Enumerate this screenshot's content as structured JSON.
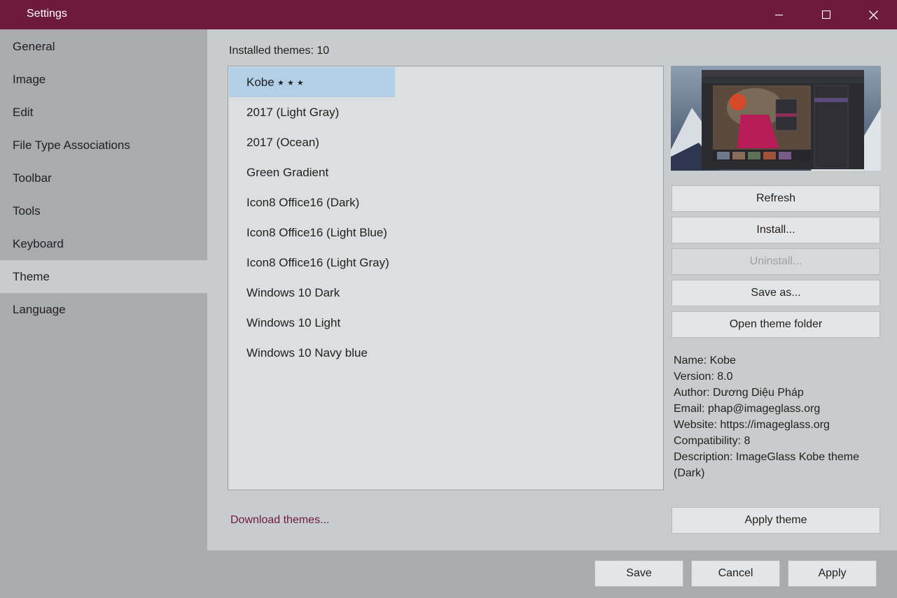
{
  "window": {
    "title": "Settings"
  },
  "sidebar": {
    "items": [
      {
        "label": "General"
      },
      {
        "label": "Image"
      },
      {
        "label": "Edit"
      },
      {
        "label": "File Type Associations"
      },
      {
        "label": "Toolbar"
      },
      {
        "label": "Tools"
      },
      {
        "label": "Keyboard"
      },
      {
        "label": "Theme",
        "active": true
      },
      {
        "label": "Language"
      }
    ]
  },
  "theme_page": {
    "installed_label": "Installed themes: 10",
    "themes": [
      {
        "name": "Kobe ⭑ ⭑ ⭑",
        "selected": true
      },
      {
        "name": "2017 (Light Gray)"
      },
      {
        "name": "2017 (Ocean)"
      },
      {
        "name": "Green Gradient"
      },
      {
        "name": "Icon8 Office16 (Dark)"
      },
      {
        "name": "Icon8 Office16 (Light Blue)"
      },
      {
        "name": "Icon8 Office16 (Light Gray)"
      },
      {
        "name": "Windows 10 Dark"
      },
      {
        "name": "Windows 10 Light"
      },
      {
        "name": "Windows 10 Navy blue"
      }
    ],
    "buttons": {
      "refresh": "Refresh",
      "install": "Install...",
      "uninstall": "Uninstall...",
      "save_as": "Save as...",
      "open_folder": "Open theme folder",
      "apply_theme": "Apply theme"
    },
    "info": {
      "name": "Name: Kobe",
      "version": "Version: 8.0",
      "author": "Author: Dương Diệu Pháp",
      "email": "Email: phap@imageglass.org",
      "website": "Website: https://imageglass.org",
      "compatibility": "Compatibility: 8",
      "description": "Description: ImageGlass Kobe theme (Dark)"
    },
    "download_link": "Download themes..."
  },
  "footer": {
    "save": "Save",
    "cancel": "Cancel",
    "apply": "Apply"
  },
  "colors": {
    "titlebar": "#6e1a3c",
    "selection": "#b3cfe8",
    "link": "#6e1a3c"
  }
}
